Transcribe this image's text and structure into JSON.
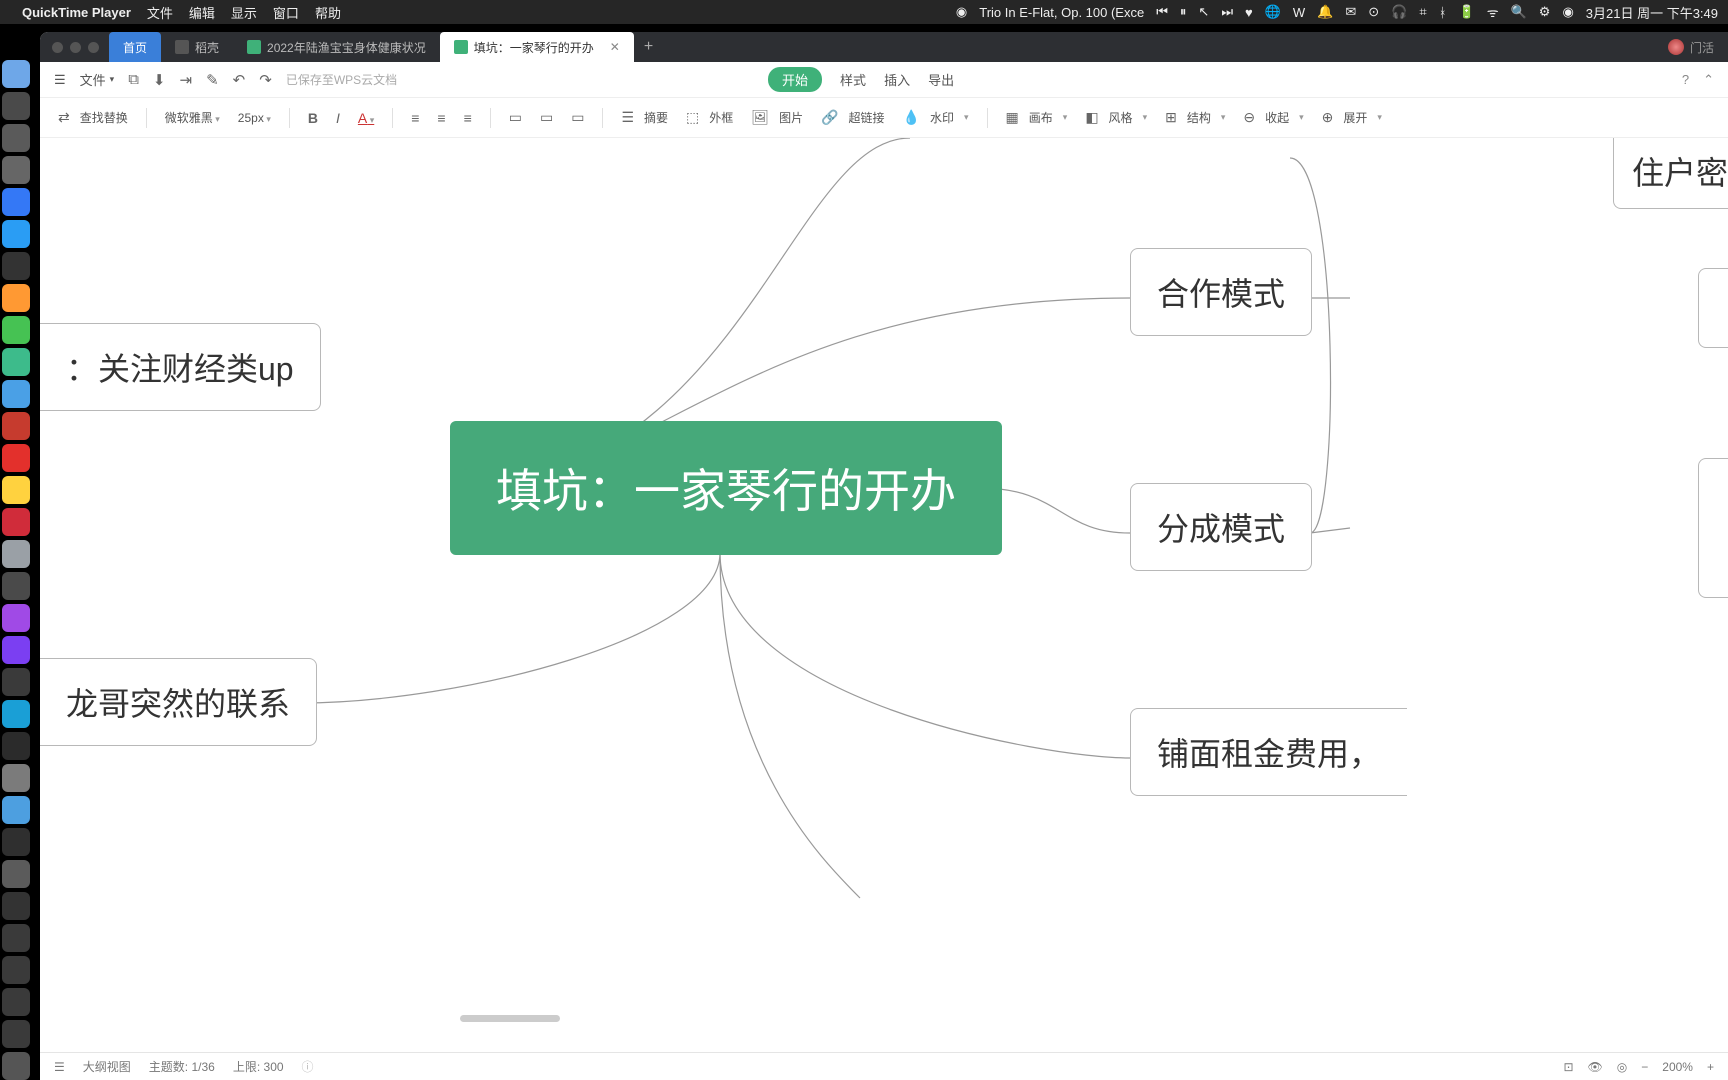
{
  "menubar": {
    "app": "QuickTime Player",
    "items": [
      "文件",
      "编辑",
      "显示",
      "窗口",
      "帮助"
    ],
    "nowplaying": "Trio In E-Flat, Op. 100 (Exce",
    "date": "3月21日 周一 下午3:49"
  },
  "tabs": {
    "home": "首页",
    "t1": "稻壳",
    "t2": "2022年陆渔宝宝身体健康状况",
    "t3": "填坑：一家琴行的开办",
    "user": "门活"
  },
  "topbar": {
    "file": "文件",
    "saved": "已保存至WPS云文档",
    "start": "开始",
    "style": "样式",
    "insert": "插入",
    "export": "导出"
  },
  "ribbon": {
    "find": "查找替换",
    "font": "微软雅黑",
    "size": "25px",
    "outline": "摘要",
    "border": "外框",
    "image": "图片",
    "link": "超链接",
    "watermark": "水印",
    "canvas": "画布",
    "style": "风格",
    "structure": "结构",
    "collapse": "收起",
    "expand": "展开"
  },
  "mindmap": {
    "center": "填坑：一家琴行的开办",
    "n_left1": "：关注财经类up",
    "n_left2": "龙哥突然的联系",
    "n_r1": "住户密",
    "n_r2": "合作模式",
    "n_r3": "分成模式",
    "n_r4": "铺面租金费用，"
  },
  "status": {
    "outline": "大纲视图",
    "topics_label": "主题数:",
    "topics_val": "1/36",
    "limit_label": "上限:",
    "limit_val": "300",
    "zoom": "200%"
  },
  "dock_colors": [
    "#6ea7e8",
    "#4a4a4a",
    "#5a5a5a",
    "#666",
    "#3478f6",
    "#2a9df4",
    "#333",
    "#ff9933",
    "#46c253",
    "#3dbb8b",
    "#4aa0e6",
    "#c63b2e",
    "#e3302c",
    "#ffd23f",
    "#d02c3a",
    "#9aa0a6",
    "#4a4a4a",
    "#a04ae6",
    "#7b3ff2",
    "#3a3a3a",
    "#1a9fd6",
    "#2b2b2b",
    "#7b7b7b",
    "#4d9fe0",
    "#2f2f2f",
    "#5b5b5b",
    "#333",
    "#3a3a3a",
    "#3a3a3a",
    "#3a3a3a",
    "#3a3a3a",
    "#555"
  ]
}
